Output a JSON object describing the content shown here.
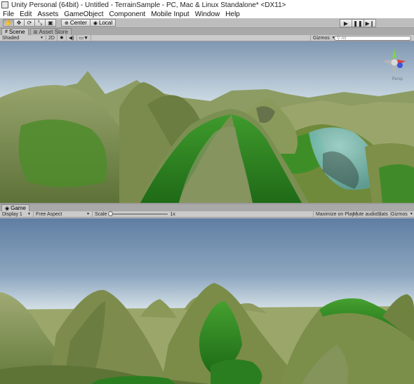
{
  "window": {
    "title": "Unity Personal (64bit) - Untitled - TerrainSample - PC, Mac & Linux Standalone* <DX11>"
  },
  "menu": [
    "File",
    "Edit",
    "Assets",
    "GameObject",
    "Component",
    "Mobile Input",
    "Window",
    "Help"
  ],
  "toolbar": {
    "tools": [
      "hand-tool",
      "move-tool",
      "rotate-tool",
      "scale-tool",
      "rect-tool"
    ],
    "pivot_label": "Center",
    "space_label": "Local",
    "play_controls": [
      "play",
      "pause",
      "step"
    ]
  },
  "scene_panel": {
    "tabs": [
      {
        "label": "Scene",
        "icon": "scene-icon",
        "active": true
      },
      {
        "label": "Asset Store",
        "icon": "store-icon",
        "active": false
      }
    ],
    "shading_mode": "Shaded",
    "mode_2d": "2D",
    "gizmos_label": "Gizmos",
    "search_placeholder": "All",
    "projection_label": "Persp"
  },
  "game_panel": {
    "tab_label": "Game",
    "display": "Display 1",
    "aspect": "Free Aspect",
    "scale_label": "Scale",
    "scale_value": "1x",
    "scale_fraction": 0.0,
    "buttons": [
      "Maximize on Play",
      "Mute audio",
      "Stats",
      "Gizmos"
    ]
  },
  "colors": {
    "toolbar_bg": "#bdbdbd",
    "sky_top": "#6a86a8",
    "sky_bottom": "#e9f0f2",
    "terrain_green": "#6f8a3a",
    "grass_bright": "#2f8a24",
    "water_cyan": "#7fc7d2"
  }
}
